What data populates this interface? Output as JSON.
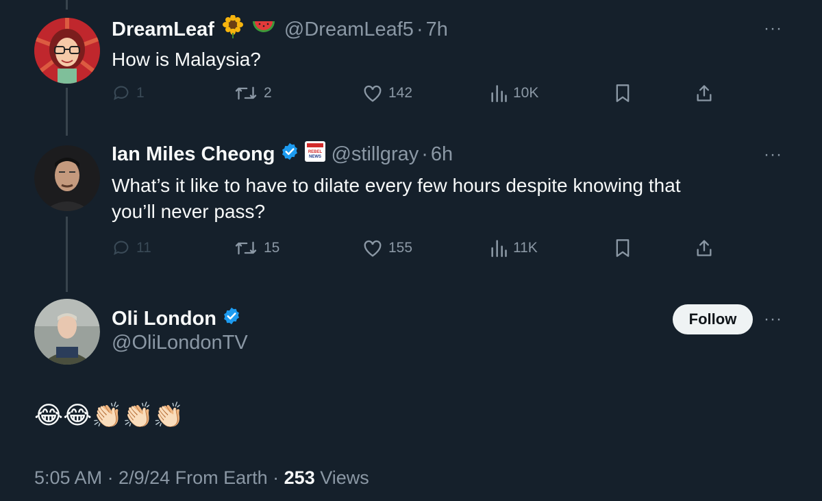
{
  "tweets": [
    {
      "name": "DreamLeaf",
      "badges": [
        "sunflower-emoji",
        "watermelon-emoji"
      ],
      "handle": "@DreamLeaf5",
      "time": "7h",
      "text": "How is Malaysia?",
      "replies": "1",
      "retweets": "2",
      "likes": "142",
      "views": "10K"
    },
    {
      "name": "Ian Miles Cheong",
      "verified": true,
      "affiliate_badge": "REBEL NEWS",
      "handle": "@stillgray",
      "time": "6h",
      "text_line1": "What’s it like to have to dilate every few hours despite knowing that",
      "text_line2": "you’ll never pass?",
      "replies": "11",
      "retweets": "15",
      "likes": "155",
      "views": "11K"
    }
  ],
  "main": {
    "name": "Oli London",
    "verified": true,
    "handle": "@OliLondonTV",
    "follow_label": "Follow",
    "emojis": "😂😂👏🏻👏🏻👏🏻",
    "footer_time": "5:05 AM · 2/9/24 From Earth · ",
    "footer_views_count": "253",
    "footer_views_label": " Views"
  },
  "separator": "·",
  "more_label": "···",
  "colors": {
    "background": "#15202b",
    "text": "#f7f9f9",
    "secondary": "#8b98a5",
    "verified": "#1d9bf0"
  }
}
